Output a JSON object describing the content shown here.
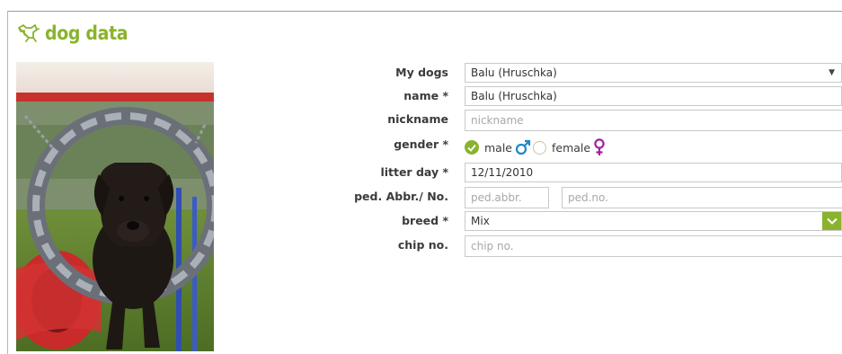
{
  "header": {
    "title": "dog data",
    "icon": "dog-icon"
  },
  "form": {
    "my_dogs": {
      "label": "My dogs",
      "value": "Balu (Hruschka)"
    },
    "name": {
      "label": "name *",
      "value": "Balu (Hruschka)"
    },
    "nickname": {
      "label": "nickname",
      "placeholder": "nickname"
    },
    "gender": {
      "label": "gender *",
      "male": "male",
      "female": "female",
      "selected": "male"
    },
    "litter_day": {
      "label": "litter day *",
      "value": "12/11/2010"
    },
    "pedigree": {
      "label": "ped. Abbr./ No.",
      "abbr_placeholder": "ped.abbr.",
      "no_placeholder": "ped.no."
    },
    "breed": {
      "label": "breed *",
      "value": "Mix"
    },
    "chip": {
      "label": "chip no.",
      "placeholder": "chip no."
    }
  },
  "colors": {
    "accent": "#8ab32d",
    "male": "#1e88c8",
    "female": "#a020a0"
  }
}
